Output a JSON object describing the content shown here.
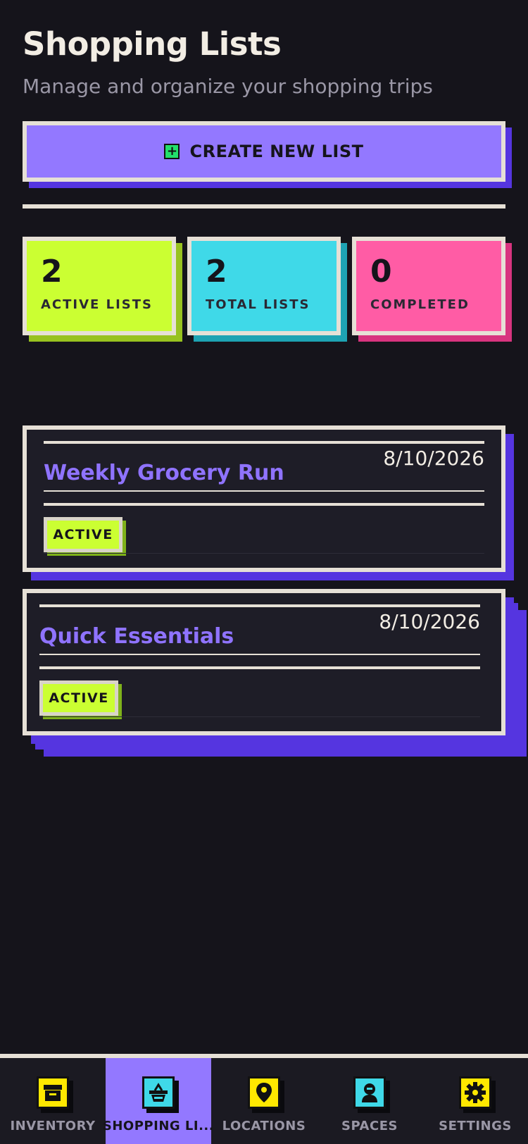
{
  "header": {
    "title": "Shopping Lists",
    "subtitle": "Manage and organize your shopping trips"
  },
  "create_button": {
    "label": "CREATE NEW LIST",
    "icon": "plus-square-icon"
  },
  "stats": [
    {
      "value": "2",
      "label": "ACTIVE LISTS",
      "color": "#cbff32"
    },
    {
      "value": "2",
      "label": "TOTAL LISTS",
      "color": "#3fd9e8"
    },
    {
      "value": "0",
      "label": "COMPLETED",
      "color": "#ff5ca5"
    }
  ],
  "lists": [
    {
      "title": "Weekly Grocery Run",
      "date": "8/10/2026",
      "status": "ACTIVE"
    },
    {
      "title": "Quick Essentials",
      "date": "8/10/2026",
      "status": "ACTIVE"
    }
  ],
  "nav": {
    "items": [
      {
        "label": "INVENTORY",
        "icon": "archive-box-icon",
        "icon_color": "#ffe800"
      },
      {
        "label": "SHOPPING LI...",
        "icon": "basket-icon",
        "icon_color": "#3fd9e8",
        "active": true
      },
      {
        "label": "LOCATIONS",
        "icon": "map-pin-icon",
        "icon_color": "#ffe800"
      },
      {
        "label": "SPACES",
        "icon": "person-icon",
        "icon_color": "#3fd9e8"
      },
      {
        "label": "SETTINGS",
        "icon": "gear-icon",
        "icon_color": "#ffe800"
      }
    ]
  },
  "colors": {
    "background": "#15141b",
    "accent": "#9378ff",
    "shadow": "#5535e0",
    "border": "#e6e0d6"
  }
}
